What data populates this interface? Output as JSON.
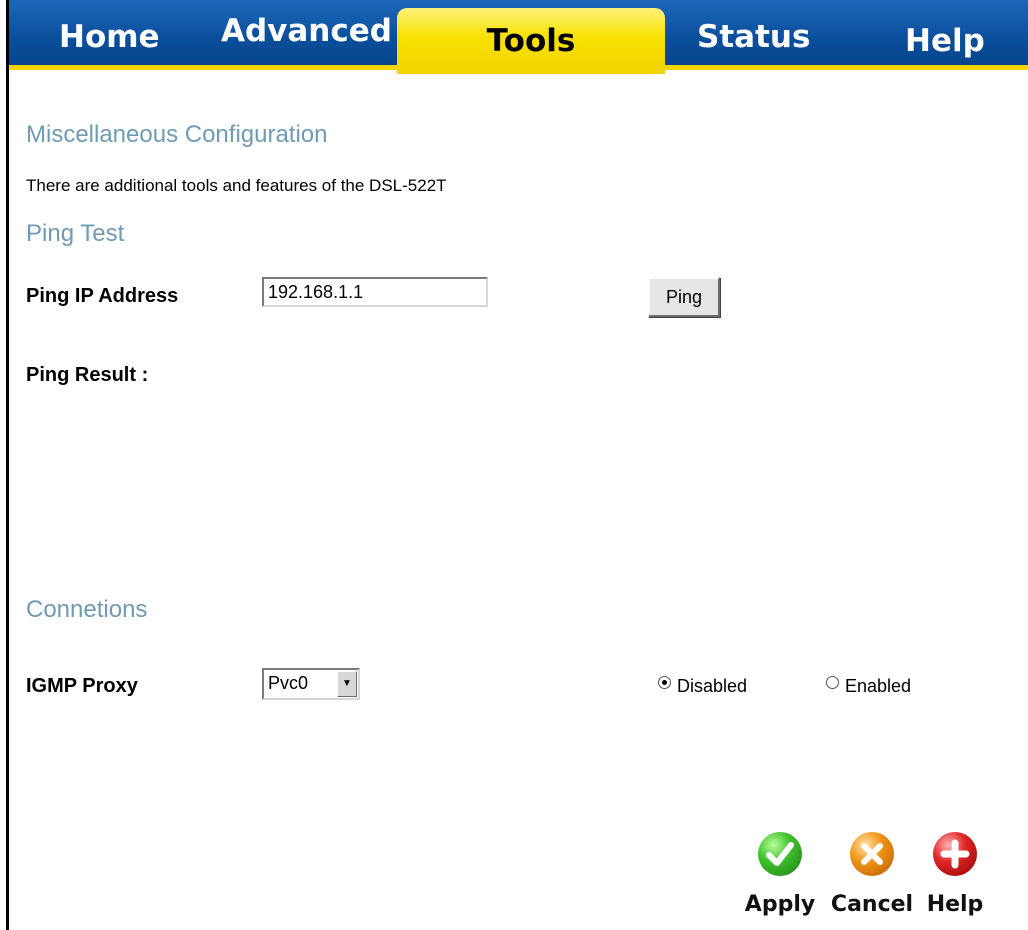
{
  "tabs": {
    "home": "Home",
    "advanced": "Advanced",
    "tools": "Tools",
    "status": "Status",
    "help": "Help",
    "active": "Tools"
  },
  "misc": {
    "title": "Miscellaneous Configuration",
    "description": "There are additional tools and features of the DSL-522T"
  },
  "ping": {
    "title": "Ping Test",
    "ip_label": "Ping IP Address",
    "ip_value": "192.168.1.1",
    "button_label": "Ping",
    "result_label": "Ping Result :"
  },
  "connections": {
    "title": "Connetions",
    "igmp_label": "IGMP Proxy",
    "pvc_selected": "Pvc0",
    "disabled_label": "Disabled",
    "enabled_label": "Enabled",
    "selected_mode": "Disabled"
  },
  "actions": {
    "apply": "Apply",
    "cancel": "Cancel",
    "help": "Help"
  },
  "colors": {
    "tab_blue": "#0a4f9c",
    "tab_active_yellow": "#f3d400",
    "section_title": "#6f9bb3"
  },
  "icons": {
    "apply": "check-icon",
    "cancel": "x-icon",
    "help": "plus-icon"
  }
}
